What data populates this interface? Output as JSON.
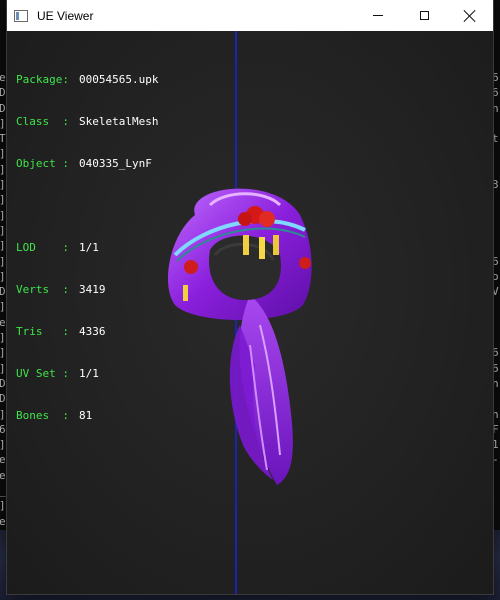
{
  "window": {
    "title": "UE Viewer"
  },
  "info": {
    "package_label": "Package:",
    "package_value": "00054565.upk",
    "class_label": "Class  :",
    "class_value": "SkeletalMesh",
    "object_label": "Object :",
    "object_value": "040335_LynF",
    "lod_label": "LOD    :",
    "lod_value": "1/1",
    "verts_label": "Verts  :",
    "verts_value": "3419",
    "tris_label": "Tris   :",
    "tris_value": "4336",
    "uvset_label": "UV Set :",
    "uvset_value": "1/1",
    "bones_label": "Bones  :",
    "bones_value": "81"
  },
  "background_console": {
    "left_chars": [
      "e",
      "D",
      "D",
      "]",
      "T",
      "]",
      "]",
      "]",
      "]",
      "]",
      "]",
      "]",
      "]",
      "]",
      "D",
      "]",
      "e",
      "]",
      "]",
      "]",
      "D",
      "D",
      "]",
      "6",
      "]",
      "e",
      "e",
      "_",
      "]",
      "e",
      "]"
    ],
    "right_chars": [
      "6",
      "6",
      "n",
      "",
      "t",
      "",
      "",
      "3",
      "",
      "",
      "",
      "",
      "6",
      "o",
      "V",
      "",
      "",
      "",
      "6",
      "6",
      "n",
      "",
      "n",
      "F",
      "1",
      "-"
    ]
  },
  "colors": {
    "label_green": "#3fe44a",
    "axis_blue": "#1d22b0",
    "hair_purple": "#9b30e8"
  },
  "icons": [
    "app-window-icon",
    "minimize-icon",
    "maximize-icon",
    "close-icon"
  ]
}
